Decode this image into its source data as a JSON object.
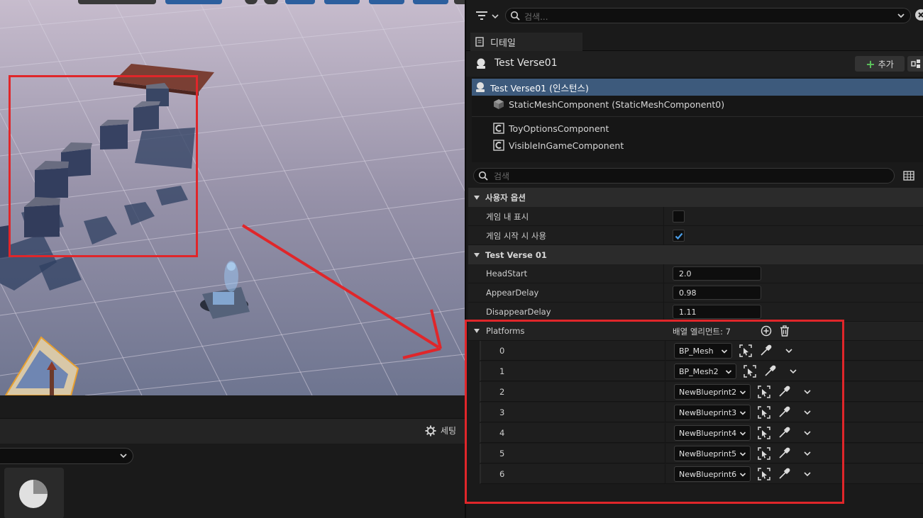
{
  "topbar": {
    "search_placeholder": "검색..."
  },
  "tabs": {
    "details_label": "디테일"
  },
  "actor": {
    "title": "Test Verse01",
    "add_label": "추가"
  },
  "components": [
    {
      "label": "Test Verse01 (인스턴스)",
      "icon": "actor-icon",
      "selected": true
    },
    {
      "label": "StaticMeshComponent (StaticMeshComponent0)",
      "icon": "static-mesh-icon",
      "selected": false
    },
    {
      "label": "ToyOptionsComponent",
      "icon": "component-icon",
      "selected": false
    },
    {
      "label": "VisibleInGameComponent",
      "icon": "component-icon",
      "selected": false
    }
  ],
  "details_search_placeholder": "검색",
  "user_options": {
    "header": "사용자 옵션",
    "show_in_game_label": "게임 내 표시",
    "show_in_game": false,
    "enabled_at_start_label": "게임 시작 시 사용",
    "enabled_at_start": true
  },
  "verse": {
    "header": "Test Verse 01",
    "headstart_label": "HeadStart",
    "headstart_value": "2.0",
    "appear_label": "AppearDelay",
    "appear_value": "0.98",
    "disappear_label": "DisappearDelay",
    "disappear_value": "1.11"
  },
  "platforms": {
    "label": "Platforms",
    "count_text": "배열 엘리먼트: 7",
    "elements": [
      {
        "index": "0",
        "value": "BP_Mesh"
      },
      {
        "index": "1",
        "value": "BP_Mesh2"
      },
      {
        "index": "2",
        "value": "NewBlueprint2"
      },
      {
        "index": "3",
        "value": "NewBlueprint3"
      },
      {
        "index": "4",
        "value": "NewBlueprint4"
      },
      {
        "index": "5",
        "value": "NewBlueprint5"
      },
      {
        "index": "6",
        "value": "NewBlueprint6"
      }
    ]
  },
  "viewport": {
    "settings_label": "세팅"
  },
  "colors": {
    "selection": "#3d5a7c",
    "annotation": "#e0262a",
    "add_plus": "#5cc45c",
    "checkbox_check": "#4a9ee8"
  }
}
